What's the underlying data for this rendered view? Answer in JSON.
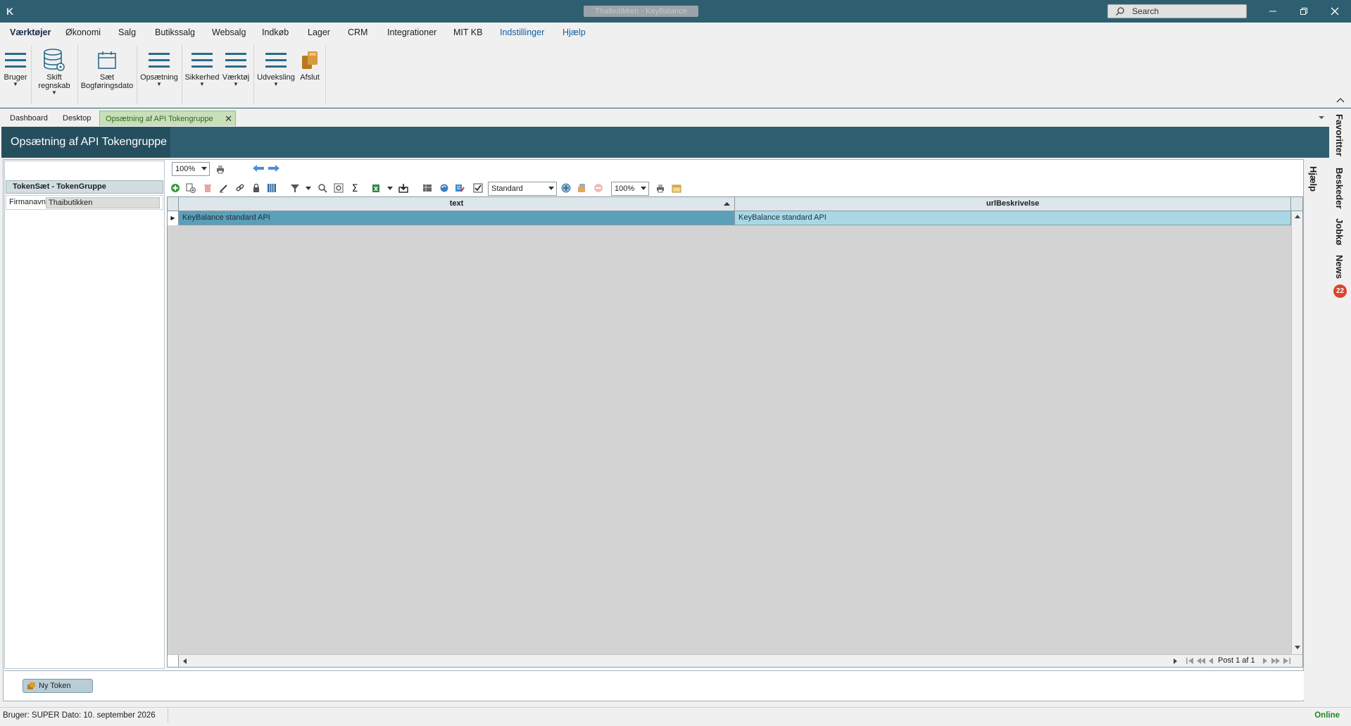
{
  "window": {
    "title": "Thaibutikken - KeyBalance",
    "search_placeholder": "Search"
  },
  "menu": {
    "items": [
      "Værktøjer",
      "Økonomi",
      "Salg",
      "Butikssalg",
      "Websalg",
      "Indkøb",
      "Lager",
      "CRM",
      "Integrationer",
      "MIT KB",
      "Indstillinger",
      "Hjælp"
    ],
    "active": "Værktøjer"
  },
  "ribbon": {
    "bruger": "Bruger",
    "skift1": "Skift",
    "skift2": "regnskab",
    "saet1": "Sæt",
    "saet2": "Bogføringsdato",
    "opsaetning": "Opsætning",
    "sikkerhed": "Sikkerhed",
    "vaerktoej": "Værktøj",
    "udveksling": "Udveksling",
    "afslut": "Afslut"
  },
  "tabs": {
    "dashboard": "Dashboard",
    "desktop": "Desktop",
    "active": "Opsætning af API Tokengruppe"
  },
  "rail": {
    "favoritter": "Favoritter",
    "beskeder": "Beskeder",
    "jobkø": "Jobkø",
    "news": "News",
    "news_count": "22",
    "hjaelp": "Hjælp"
  },
  "page": {
    "title": "Opsætning af API Tokengruppe"
  },
  "toolbar": {
    "zoom_left": "100%",
    "layout": "Standard",
    "zoom_grid": "100%"
  },
  "left_panel": {
    "group_header": "TokenSæt - TokenGruppe",
    "firmanavn_label": "Firmanavn:",
    "firmanavn_value": "Thaibutikken"
  },
  "grid": {
    "columns": [
      "text",
      "urlBeskrivelse"
    ],
    "rows": [
      {
        "text": "KeyBalance standard API",
        "urlBeskrivelse": "KeyBalance standard API"
      }
    ],
    "pager": "Post 1 af 1"
  },
  "bottom": {
    "ny_token": "Ny Token"
  },
  "status": {
    "text": "Bruger:  SUPER  Dato:  10. september 2026",
    "online": "Online"
  },
  "colors": {
    "titlebar": "#2e5f70",
    "selected_row": "#5b9fb8",
    "selected_row_light": "#a8d8e6",
    "online": "#1a8a1a"
  }
}
